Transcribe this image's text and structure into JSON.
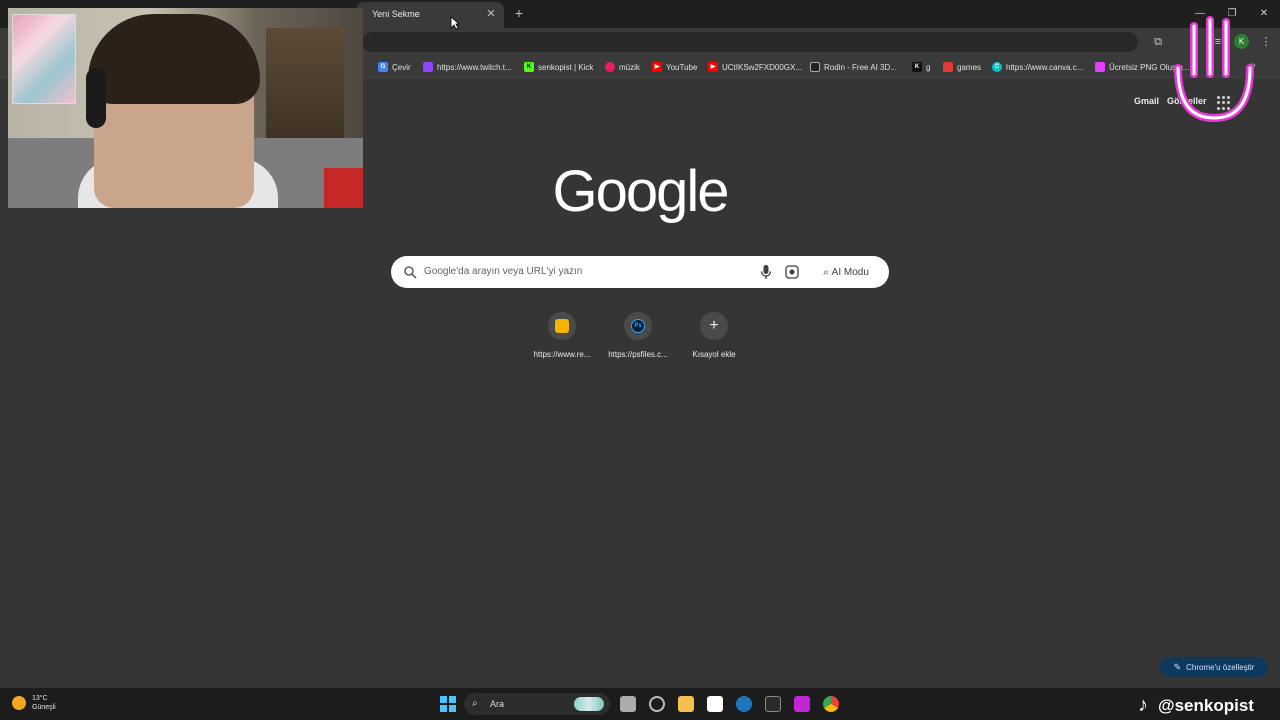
{
  "browser": {
    "tab": {
      "title": "Yeni Sekme",
      "close_icon": "close-icon"
    },
    "new_tab_icon": "plus-icon",
    "window_controls": [
      "minimize-icon",
      "restore-icon",
      "close-icon"
    ],
    "profile_initial": "K",
    "toolbar_icons": [
      "extensions-icon",
      "download-icon",
      "reading-list-icon",
      "profile-avatar",
      "menu-icon"
    ]
  },
  "bookmarks": [
    {
      "label": "Çevir",
      "icon": "translate-icon",
      "color": "#4285f4"
    },
    {
      "label": "https://www.twitch.t...",
      "icon": "twitch-icon",
      "color": "#9146ff"
    },
    {
      "label": "senkopist | Kick",
      "icon": "kick-icon",
      "color": "#53fc18"
    },
    {
      "label": "müzik",
      "icon": "music-icon",
      "color": "#e91e63"
    },
    {
      "label": "YouTube",
      "icon": "youtube-icon",
      "color": "#ff0000"
    },
    {
      "label": "UCtIKSw2FXD00GX...",
      "icon": "youtube-icon",
      "color": "#ff0000"
    },
    {
      "label": "Rodin - Free AI 3D...",
      "icon": "rodin-icon",
      "color": "#222222"
    },
    {
      "label": "g",
      "icon": "kick-icon",
      "color": "#111111"
    },
    {
      "label": "games",
      "icon": "games-icon",
      "color": "#e53935"
    },
    {
      "label": "https://www.canva.c...",
      "icon": "canva-icon",
      "color": "#00c4cc"
    },
    {
      "label": "Ücretsiz PNG Oluştu...",
      "icon": "png-icon",
      "color": "#e040fb"
    }
  ],
  "ntp": {
    "gmail_label": "Gmail",
    "images_label": "Görseller",
    "logo_text": "Google",
    "search": {
      "placeholder": "Google'da arayın veya URL'yi yazın",
      "ai_mode_label": "AI Modu"
    },
    "shortcuts": [
      {
        "label": "https://www.re...",
        "icon": "layers-icon",
        "color": "#f4b400"
      },
      {
        "label": "https://psfiles.c...",
        "icon": "photoshop-icon",
        "color": "#31a8ff"
      },
      {
        "label": "Kısayol ekle",
        "icon": "plus-icon",
        "color": "#e8eaed"
      }
    ],
    "customize_label": "Chrome'u özelleştir"
  },
  "taskbar": {
    "weather_temp": "13°C",
    "weather_desc": "Güneşli",
    "search_label": "Ara",
    "apps": [
      {
        "name": "task-view-icon",
        "color": "#cfcfcf"
      },
      {
        "name": "chatgpt-icon",
        "color": "#bdbdbd"
      },
      {
        "name": "file-explorer-icon",
        "color": "#f2c14e"
      },
      {
        "name": "store-icon",
        "color": "#ffffff"
      },
      {
        "name": "steam-icon",
        "color": "#1b75bb"
      },
      {
        "name": "epic-games-icon",
        "color": "#2a2a2a"
      },
      {
        "name": "twitch-studio-icon",
        "color": "#c026d3"
      },
      {
        "name": "chrome-icon",
        "color": "#4285f4"
      }
    ]
  },
  "overlay": {
    "tiktok_handle": "@senkopist"
  }
}
